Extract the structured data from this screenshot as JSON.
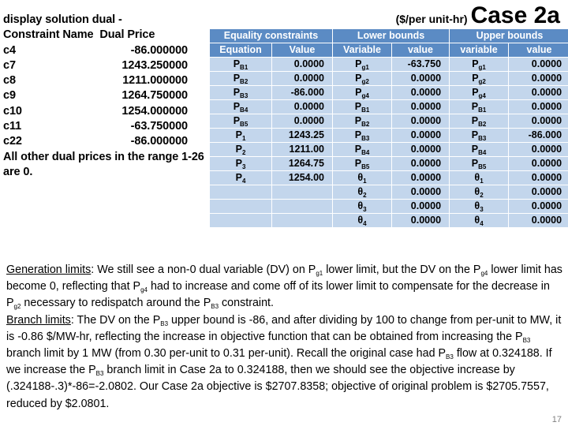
{
  "title": {
    "units_label": "($/per unit-hr)",
    "case": "Case 2a"
  },
  "console": {
    "command": "display solution dual -",
    "header": "Constraint Name  Dual Price",
    "rows": [
      {
        "name": "c4",
        "price": "-86.000000"
      },
      {
        "name": "c7",
        "price": "1243.250000"
      },
      {
        "name": "c8",
        "price": "1211.000000"
      },
      {
        "name": "c9",
        "price": "1264.750000"
      },
      {
        "name": "c10",
        "price": "1254.000000"
      },
      {
        "name": "c11",
        "price": "-63.750000"
      },
      {
        "name": "c22",
        "price": "-86.000000"
      }
    ],
    "footer": "All other dual prices in the range 1-26 are 0."
  },
  "table": {
    "group_headers": [
      "Equality constraints",
      "Lower bounds",
      "Upper bounds"
    ],
    "column_headers": [
      "Equation",
      "Value",
      "Variable",
      "value",
      "variable",
      "value"
    ],
    "rows": [
      {
        "eq_var": "P",
        "eq_sub": "B1",
        "eq_val": "0.0000",
        "lb_var": "P",
        "lb_sub": "g1",
        "lb_val": "-63.750",
        "ub_var": "P",
        "ub_sub": "g1",
        "ub_val": "0.0000"
      },
      {
        "eq_var": "P",
        "eq_sub": "B2",
        "eq_val": "0.0000",
        "lb_var": "P",
        "lb_sub": "g2",
        "lb_val": "0.0000",
        "ub_var": "P",
        "ub_sub": "g2",
        "ub_val": "0.0000"
      },
      {
        "eq_var": "P",
        "eq_sub": "B3",
        "eq_val": "-86.000",
        "lb_var": "P",
        "lb_sub": "g4",
        "lb_val": "0.0000",
        "ub_var": "P",
        "ub_sub": "g4",
        "ub_val": "0.0000"
      },
      {
        "eq_var": "P",
        "eq_sub": "B4",
        "eq_val": "0.0000",
        "lb_var": "P",
        "lb_sub": "B1",
        "lb_val": "0.0000",
        "ub_var": "P",
        "ub_sub": "B1",
        "ub_val": "0.0000"
      },
      {
        "eq_var": "P",
        "eq_sub": "B5",
        "eq_val": "0.0000",
        "lb_var": "P",
        "lb_sub": "B2",
        "lb_val": "0.0000",
        "ub_var": "P",
        "ub_sub": "B2",
        "ub_val": "0.0000"
      },
      {
        "eq_var": "P",
        "eq_sub": "1",
        "eq_val": "1243.25",
        "lb_var": "P",
        "lb_sub": "B3",
        "lb_val": "0.0000",
        "ub_var": "P",
        "ub_sub": "B3",
        "ub_val": "-86.000"
      },
      {
        "eq_var": "P",
        "eq_sub": "2",
        "eq_val": "1211.00",
        "lb_var": "P",
        "lb_sub": "B4",
        "lb_val": "0.0000",
        "ub_var": "P",
        "ub_sub": "B4",
        "ub_val": "0.0000"
      },
      {
        "eq_var": "P",
        "eq_sub": "3",
        "eq_val": "1264.75",
        "lb_var": "P",
        "lb_sub": "B5",
        "lb_val": "0.0000",
        "ub_var": "P",
        "ub_sub": "B5",
        "ub_val": "0.0000"
      },
      {
        "eq_var": "P",
        "eq_sub": "4",
        "eq_val": "1254.00",
        "lb_var": "θ",
        "lb_sub": "1",
        "lb_val": "0.0000",
        "ub_var": "θ",
        "ub_sub": "1",
        "ub_val": "0.0000"
      },
      {
        "eq_var": "",
        "eq_sub": "",
        "eq_val": "",
        "lb_var": "θ",
        "lb_sub": "2",
        "lb_val": "0.0000",
        "ub_var": "θ",
        "ub_sub": "2",
        "ub_val": "0.0000"
      },
      {
        "eq_var": "",
        "eq_sub": "",
        "eq_val": "",
        "lb_var": "θ",
        "lb_sub": "3",
        "lb_val": "0.0000",
        "ub_var": "θ",
        "ub_sub": "3",
        "ub_val": "0.0000"
      },
      {
        "eq_var": "",
        "eq_sub": "",
        "eq_val": "",
        "lb_var": "θ",
        "lb_sub": "4",
        "lb_val": "0.0000",
        "ub_var": "θ",
        "ub_sub": "4",
        "ub_val": "0.0000"
      }
    ]
  },
  "notes": {
    "generation_label": "Generation limits",
    "generation_text_1": ": We still see a non-0 dual variable (DV) on P",
    "generation_sub_1": "g1",
    "generation_text_2": " lower limit, but the DV on the P",
    "generation_sub_2": "g4",
    "generation_text_3": " lower limit has become 0, reflecting that P",
    "generation_sub_3": "g4",
    "generation_text_4": " had to increase and come off of its lower limit to compensate for the decrease in P",
    "generation_sub_4": "g2",
    "generation_text_5": " necessary to redispatch around the P",
    "generation_sub_5": "B3",
    "generation_text_6": " constraint.",
    "branch_label": "Branch limits",
    "branch_text_1": ": The DV on the P",
    "branch_sub_1": "B3",
    "branch_text_2": " upper bound is -86, and after dividing by 100 to change from per-unit to MW, it is -0.86 $/MW-hr, reflecting the increase in objective function that can be obtained from increasing the P",
    "branch_sub_2": "B3",
    "branch_text_3": " branch limit by 1 MW (from 0.30 per-unit to 0.31 per-unit). Recall the original case had P",
    "branch_sub_3": "B3",
    "branch_text_4": " flow at 0.324188. If we increase the P",
    "branch_sub_4": "B3",
    "branch_text_5": " branch limit in Case 2a to 0.324188, then we should see the objective increase by (.324188-.3)*-86=-2.0802. Our Case 2a objective is $2707.8358; objective of original problem is $2705.7557, reduced by $2.0801."
  },
  "page_number": "17",
  "colors": {
    "header_blue": "#5b8bc4",
    "cell_blue": "#c3d6ec",
    "page_number_gray": "#7f7f7f"
  }
}
